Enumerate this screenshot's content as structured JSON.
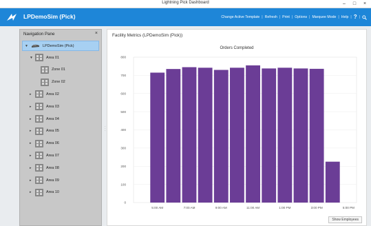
{
  "window": {
    "title": "Lightning Pick Dashboard",
    "minimize": "–",
    "maximize": "□",
    "close": "×"
  },
  "header": {
    "app_title": "LPDemoSim (Pick)",
    "links": [
      "Change Active Template",
      "Refresh",
      "Print",
      "Options",
      "Marquee Mode",
      "Help"
    ],
    "help_symbol": "?"
  },
  "nav": {
    "title": "Navigation Pane",
    "close": "×",
    "root": "LPDemoSim (Pick)",
    "items": [
      {
        "label": "Area 01",
        "level": 1,
        "expanded": true
      },
      {
        "label": "Zone 01",
        "level": 2
      },
      {
        "label": "Zone 02",
        "level": 2
      },
      {
        "label": "Area 02",
        "level": 1
      },
      {
        "label": "Area 03",
        "level": 1
      },
      {
        "label": "Area 04",
        "level": 1
      },
      {
        "label": "Area 05",
        "level": 1
      },
      {
        "label": "Area 06",
        "level": 1
      },
      {
        "label": "Area 07",
        "level": 1
      },
      {
        "label": "Area 08",
        "level": 1
      },
      {
        "label": "Area 09",
        "level": 1
      },
      {
        "label": "Area 10",
        "level": 1
      }
    ]
  },
  "main": {
    "title": "Facility Metrics (LPDemoSim (Pick))",
    "show_employees": "Show Employees"
  },
  "colors": {
    "header": "#1e86d8",
    "bar": "#6b3d96",
    "selection": "#a7d0f2"
  },
  "chart_data": {
    "type": "bar",
    "title": "Orders Completed",
    "xlabel": "",
    "ylabel": "",
    "ylim": [
      0,
      800
    ],
    "yticks": [
      0,
      100,
      200,
      300,
      400,
      500,
      600,
      700,
      800
    ],
    "xtick_labels": [
      "5:00 AM",
      "7:00 AM",
      "9:00 AM",
      "11:00 AM",
      "1:00 PM",
      "3:00 PM",
      "5:00 PM"
    ],
    "categories": [
      "4:00 AM",
      "5:00 AM",
      "6:00 AM",
      "7:00 AM",
      "8:00 AM",
      "9:00 AM",
      "10:00 AM",
      "11:00 AM",
      "12:00 PM",
      "1:00 PM",
      "2:00 PM",
      "3:00 PM",
      "4:00 PM",
      "5:00 PM"
    ],
    "values": [
      0,
      715,
      735,
      745,
      742,
      730,
      742,
      755,
      738,
      742,
      738,
      736,
      225,
      0
    ],
    "grid": true
  }
}
